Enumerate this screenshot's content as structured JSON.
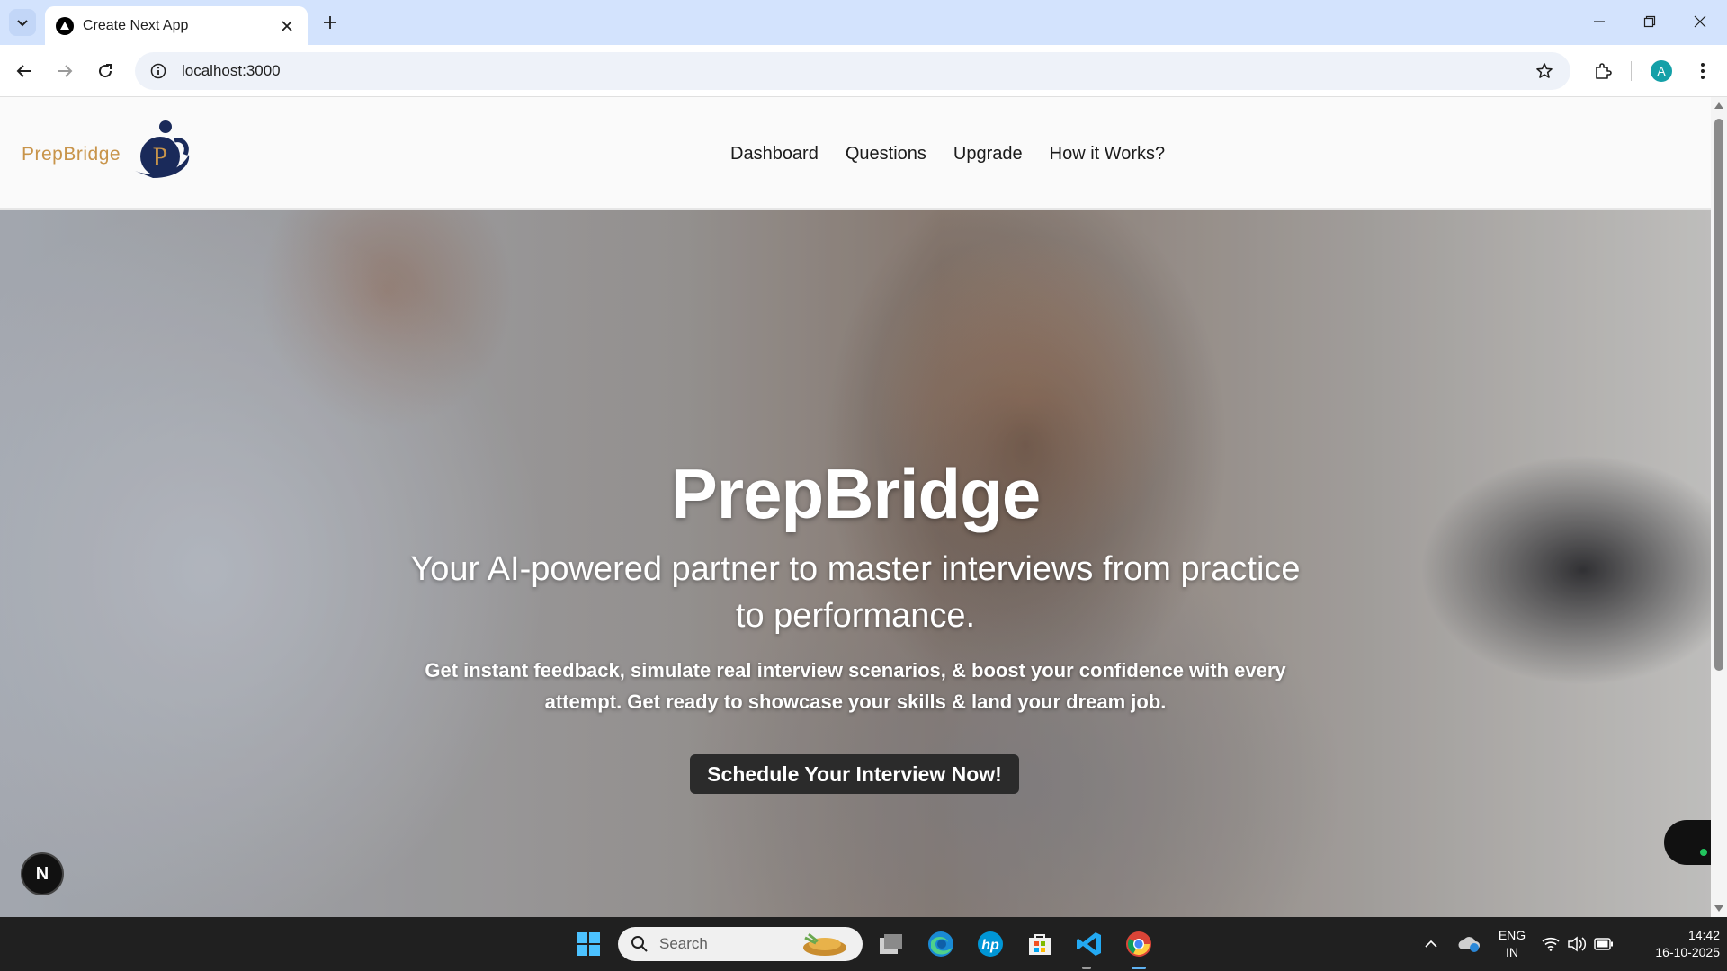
{
  "browser": {
    "tab_title": "Create Next App",
    "url": "localhost:3000",
    "profile_initial": "A"
  },
  "site": {
    "brand_name": "PrepBridge",
    "brand_logo_letter": "P",
    "nav": [
      "Dashboard",
      "Questions",
      "Upgrade",
      "How it Works?"
    ],
    "hero": {
      "title": "PrepBridge",
      "subtitle": "Your AI-powered partner to master interviews from practice to performance.",
      "description": "Get instant feedback, simulate real interview scenarios, & boost your confidence with every attempt. Get ready to showcase your skills & land your dream job.",
      "cta_label": "Schedule Your Interview Now!"
    },
    "dev_badge": "N"
  },
  "taskbar": {
    "search_placeholder": "Search",
    "language_line1": "ENG",
    "language_line2": "IN",
    "time": "14:42",
    "date": "16-10-2025"
  },
  "colors": {
    "brand_gold": "#c8944a",
    "brand_navy": "#1a2a5a",
    "cta_bg": "#2b2b2b",
    "browser_tabbar": "#d3e3fd"
  }
}
